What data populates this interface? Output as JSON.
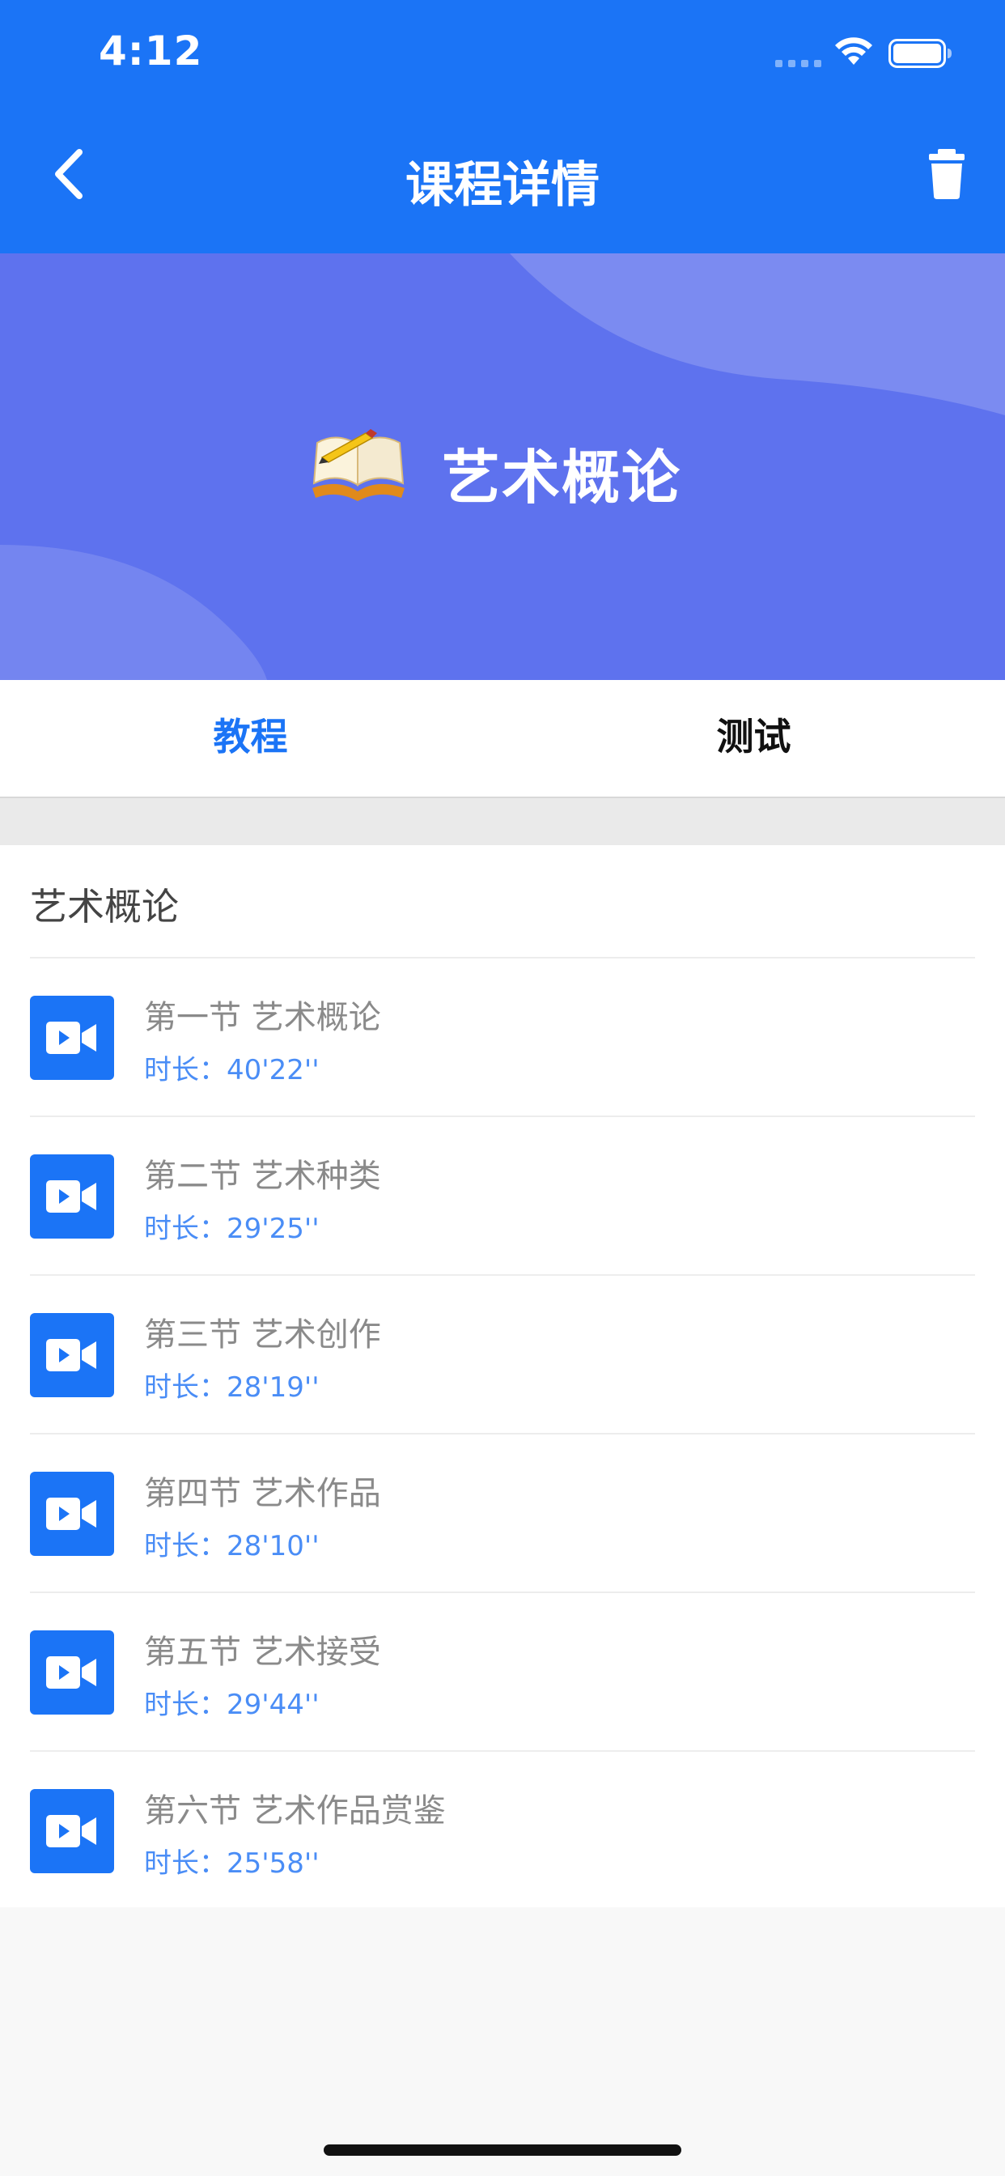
{
  "status_bar": {
    "time": "4:12"
  },
  "nav": {
    "title": "课程详情"
  },
  "banner": {
    "title": "艺术概论"
  },
  "tabs": [
    {
      "label": "教程",
      "active": true
    },
    {
      "label": "测试",
      "active": false
    }
  ],
  "section": {
    "title": "艺术概论"
  },
  "lessons": [
    {
      "title": "第一节 艺术概论",
      "duration_label": "时长：",
      "duration": "40'22''"
    },
    {
      "title": "第二节 艺术种类",
      "duration_label": "时长：",
      "duration": "29'25''"
    },
    {
      "title": "第三节 艺术创作",
      "duration_label": "时长：",
      "duration": "28'19''"
    },
    {
      "title": "第四节 艺术作品",
      "duration_label": "时长：",
      "duration": "28'10''"
    },
    {
      "title": "第五节 艺术接受",
      "duration_label": "时长：",
      "duration": "29'44''"
    },
    {
      "title": "第六节 艺术作品赏鉴",
      "duration_label": "时长：",
      "duration": "25'58''"
    }
  ],
  "colors": {
    "primary": "#1B74F6",
    "banner": "#5E72EE",
    "duration": "#4A8DF6"
  },
  "icons": [
    "back-arrow-icon",
    "trash-icon",
    "book-icon",
    "video-camera-icon",
    "wifi-icon",
    "battery-icon"
  ]
}
